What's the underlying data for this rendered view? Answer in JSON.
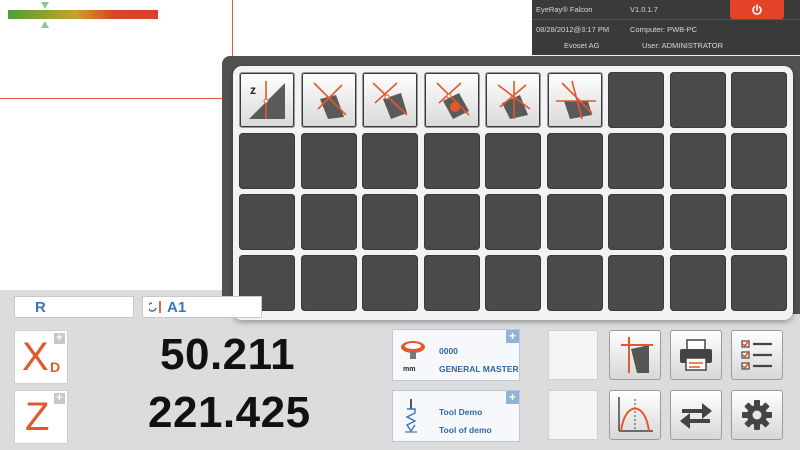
{
  "header": {
    "app_name": "EyeRay® Falcon",
    "version": "V1.0.1.7",
    "datetime": "08/28/2012@3:17 PM",
    "computer": "Computer: PWB-PC",
    "company": "Evoset AG",
    "user": "User: ADMINISTRATOR"
  },
  "colors": {
    "accent": "#e2582b",
    "power": "#e4432a",
    "palette_bg": "#515151",
    "label_blue": "#3a76b8"
  },
  "labels": {
    "mode": "R",
    "reference": "A1"
  },
  "axes": {
    "x": {
      "letter": "X",
      "subscript": "D",
      "value": "50.211"
    },
    "z": {
      "letter": "Z",
      "value": "221.425"
    }
  },
  "cards": {
    "master": {
      "number": "0000",
      "unit": "mm",
      "name": "GENERAL MASTER"
    },
    "tool": {
      "title": "Tool Demo",
      "subtitle": "Tool of demo"
    }
  },
  "corner_plus": "+",
  "palette_tools": [
    {
      "icon": "z-zero-measure-icon",
      "letter": "z"
    },
    {
      "icon": "edge-measure-icon"
    },
    {
      "icon": "corner-measure-icon"
    },
    {
      "icon": "radius-measure-icon"
    },
    {
      "icon": "angle-measure-icon"
    },
    {
      "icon": "flat-edge-measure-icon"
    }
  ],
  "buttons": [
    "tool-shape-icon",
    "printer-icon",
    "checklist-icon",
    "profile-curve-icon",
    "swap-arrows-icon",
    "gear-icon",
    "power-icon"
  ]
}
